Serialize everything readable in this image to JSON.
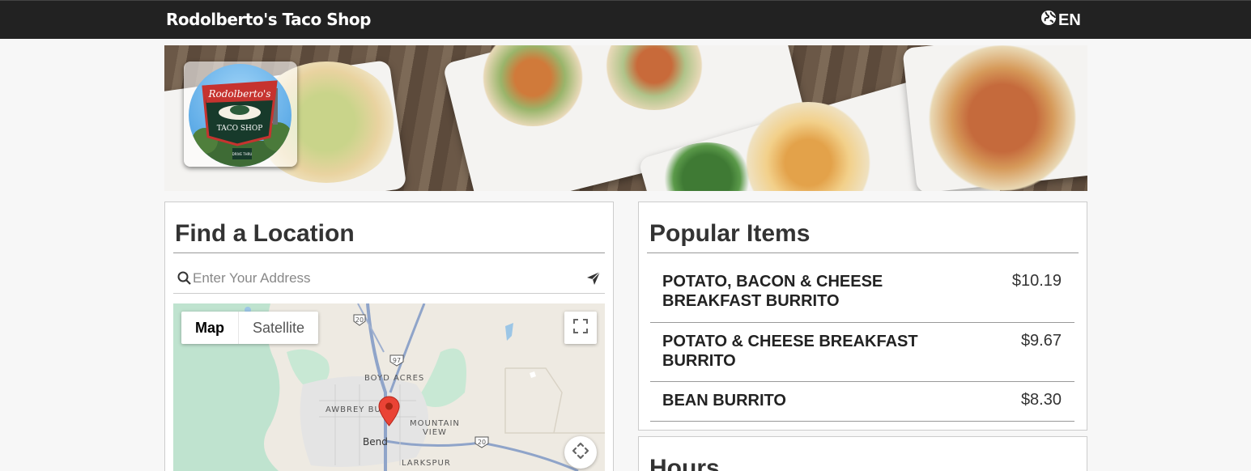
{
  "header": {
    "brand": "Rodolberto's Taco Shop",
    "language": "EN",
    "language_icon": "globe-icon"
  },
  "logo": {
    "sign_top": "Rodolberto's",
    "sign_bottom": "TACO SHOP",
    "drive": "DRIVE THRU"
  },
  "locations": {
    "title": "Find a Location",
    "address_placeholder": "Enter Your Address",
    "search_icon": "search-icon",
    "locate_icon": "paper-plane-icon",
    "map": {
      "type_map": "Map",
      "type_satellite": "Satellite",
      "labels": {
        "boyd_acres": "BOYD ACRES",
        "awbrey_butte": "AWBREY BUT",
        "mountain_view_1": "MOUNTAIN",
        "mountain_view_2": "VIEW",
        "bend": "Bend",
        "larkspur": "LARKSPUR",
        "hwy20_a": "20",
        "hwy97": "97",
        "hwy20_b": "20"
      }
    }
  },
  "popular": {
    "title": "Popular Items",
    "items": [
      {
        "name": "POTATO, BACON & CHEESE BREAKFAST BURRITO",
        "price": "$10.19"
      },
      {
        "name": "POTATO & CHEESE BREAKFAST BURRITO",
        "price": "$9.67"
      },
      {
        "name": "BEAN BURRITO",
        "price": "$8.30"
      }
    ]
  },
  "hours": {
    "title": "Hours"
  },
  "colors": {
    "topbar": "#222222",
    "pin": "#ea4335"
  }
}
